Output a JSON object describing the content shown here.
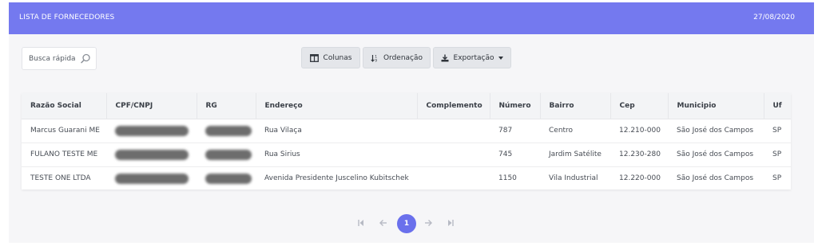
{
  "header": {
    "title": "LISTA DE FORNECEDORES",
    "date": "27/08/2020"
  },
  "search": {
    "placeholder": "Busca rápida",
    "icon": "search-icon"
  },
  "toolbar": {
    "columns_label": "Colunas",
    "columns_icon": "columns-icon",
    "sort_label": "Ordenação",
    "sort_icon": "sort-icon",
    "export_label": "Exportação",
    "export_icon": "download-icon"
  },
  "table": {
    "columns": [
      "Razão Social",
      "CPF/CNPJ",
      "RG",
      "Endereço",
      "Complemento",
      "Número",
      "Bairro",
      "Cep",
      "Municipio",
      "Uf"
    ],
    "rows": [
      {
        "razao": "Marcus Guarani ME",
        "endereco": "Rua Vilaça",
        "complemento": "",
        "numero": "787",
        "bairro": "Centro",
        "cep": "12.210-000",
        "municipio": "São José dos Campos",
        "uf": "SP"
      },
      {
        "razao": "FULANO TESTE ME",
        "endereco": "Rua Sirius",
        "complemento": "",
        "numero": "745",
        "bairro": "Jardim Satélite",
        "cep": "12.230-280",
        "municipio": "São José dos Campos",
        "uf": "SP"
      },
      {
        "razao": "TESTE ONE LTDA",
        "endereco": "Avenida Presidente Juscelino Kubitschek",
        "complemento": "",
        "numero": "1150",
        "bairro": "Vila Industrial",
        "cep": "12.220-000",
        "municipio": "São José dos Campos",
        "uf": "SP"
      }
    ]
  },
  "pagination": {
    "current_page": "1"
  },
  "colors": {
    "header_bg": "#7479ef",
    "accent": "#6a70ec",
    "panel_bg": "#f6f6f8"
  }
}
